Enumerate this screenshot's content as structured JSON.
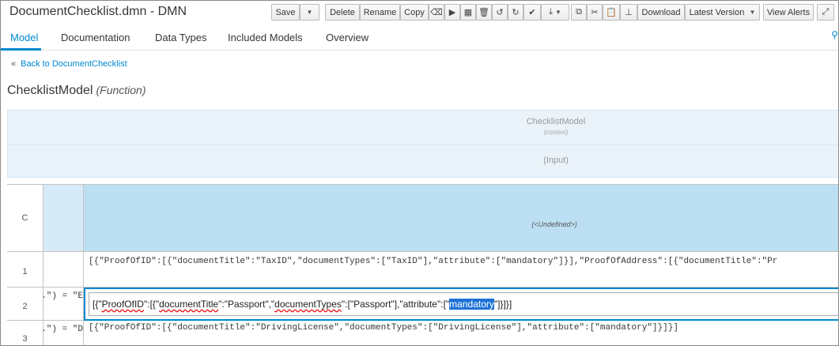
{
  "window": {
    "title": "DocumentChecklist.dmn - DMN"
  },
  "toolbar": {
    "save": "Save",
    "delete": "Delete",
    "rename": "Rename",
    "copy": "Copy",
    "download": "Download",
    "latest_version": "Latest Version",
    "view_alerts": "View Alerts"
  },
  "tabs": {
    "model": "Model",
    "documentation": "Documentation",
    "data_types": "Data Types",
    "included_models": "Included Models",
    "overview": "Overview"
  },
  "back_link": "Back to DocumentChecklist",
  "function": {
    "name": "ChecklistModel",
    "kind": "(Function)"
  },
  "context": {
    "name": "ChecklistModel",
    "sub": "(context)",
    "input": "(Input)"
  },
  "grid": {
    "header_c": "C",
    "header_undefined": "(<Undefined>)",
    "rows": [
      {
        "num": "1",
        "left": "",
        "value": "[{\"ProofOfID\":[{\"documentTitle\":\"TaxID\",\"documentTypes\":[\"TaxID\"],\"attribute\":[\"mandatory\"]}],\"ProofOfAddress\":[{\"documentTitle\":\"Pr"
      },
      {
        "num": "2",
        "left": ".\") = \"E",
        "value": ""
      },
      {
        "num": "3",
        "left": ".\") = \"D",
        "value": "[{\"ProofOfID\":[{\"documentTitle\":\"DrivingLicense\",\"documentTypes\":[\"DrivingLicense\"],\"attribute\":[\"mandatory\"]}]}]"
      }
    ],
    "editor": {
      "p1": "[{\"",
      "w1": "ProofOfID",
      "p2": "\":[{\"",
      "w2": "documentTitle",
      "p3": "\":\"Passport\",\"",
      "w3": "documentTypes",
      "p4": "\":[\"Passport\"],\"attribute\":[\"",
      "sel": "mandatory",
      "p5": "\"]}]}]"
    }
  },
  "icons": [
    "caret-down-icon",
    "eraser-icon",
    "play-icon",
    "grid-icon",
    "trash-icon",
    "undo-icon",
    "redo-icon",
    "check-icon",
    "download-icon",
    "copy-icon",
    "cut-icon",
    "paste-icon",
    "hierarchy-icon",
    "expand-icon",
    "search-icon"
  ],
  "colors": {
    "accent": "#0088ce",
    "header_fill": "#bcdff3",
    "context_fill": "#eaf3fa",
    "selection": "#1e72d8"
  }
}
